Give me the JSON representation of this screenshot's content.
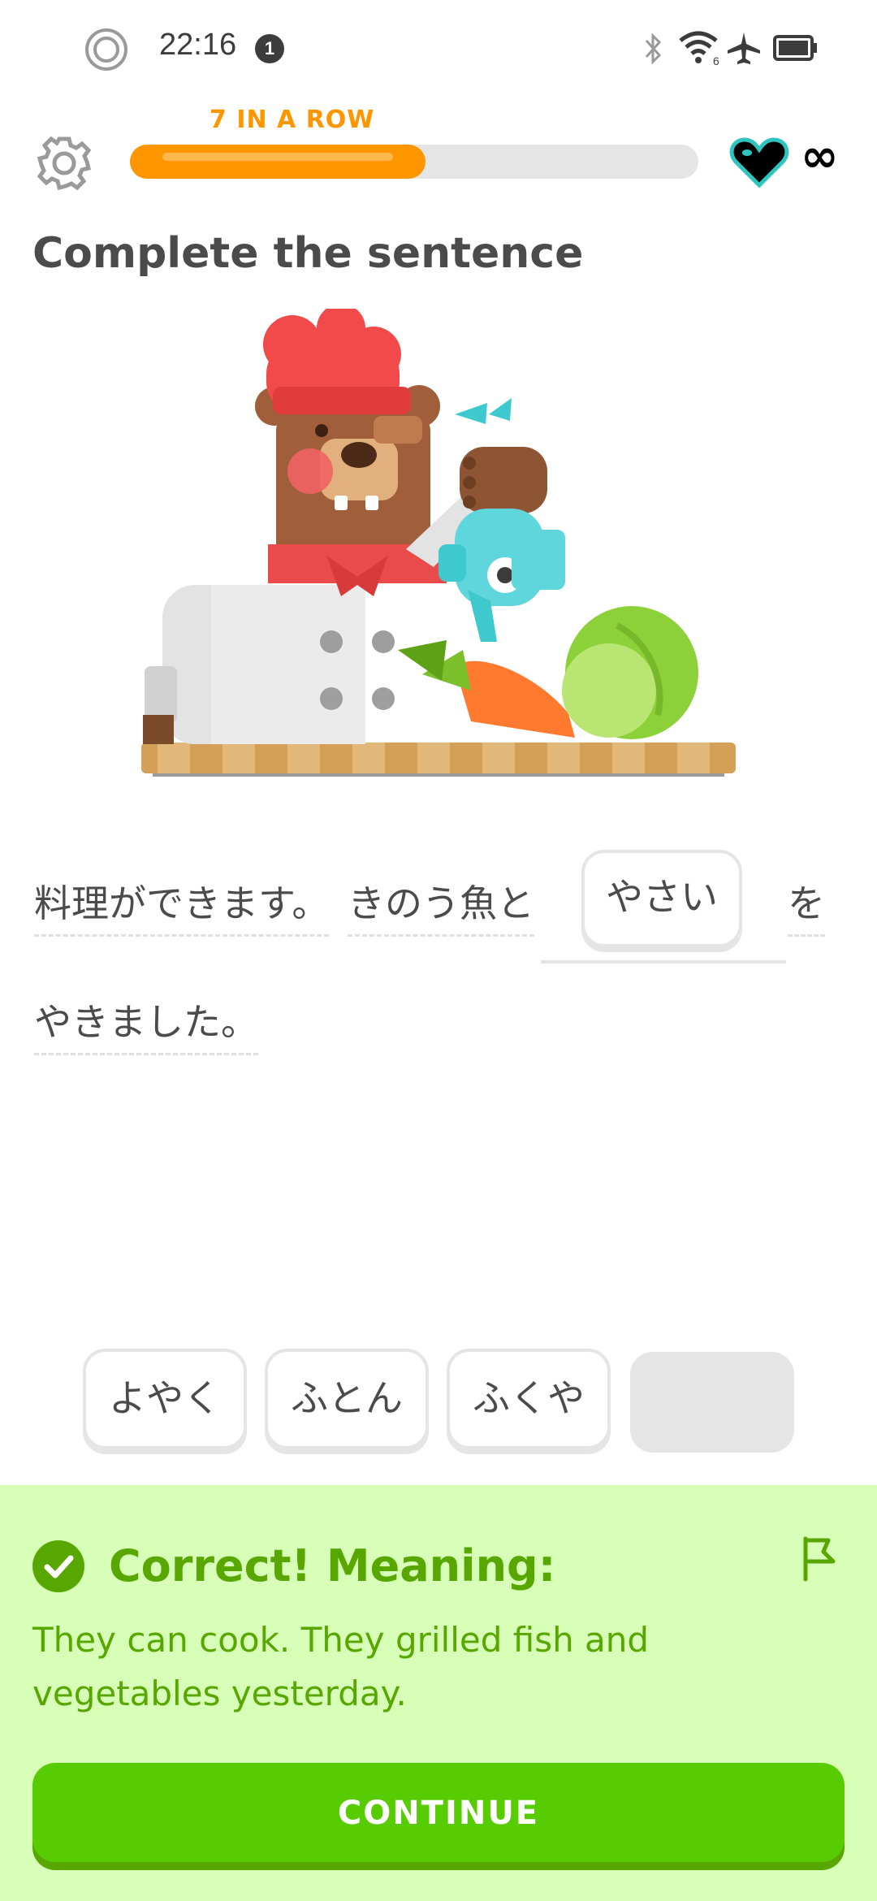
{
  "status_bar": {
    "time": "22:16",
    "notification_count": "1",
    "icons": [
      "circle-icon",
      "bluetooth-icon",
      "wifi-icon",
      "airplane-icon",
      "battery-icon"
    ]
  },
  "top_bar": {
    "streak_label": "7 IN A ROW",
    "progress_fraction": 0.52,
    "hearts": "∞",
    "accent_orange": "#ff9600"
  },
  "prompt": {
    "title": "Complete the sentence"
  },
  "sentence": {
    "part1": "料理ができます。",
    "part2": "きのう魚と",
    "answer": "やさい",
    "part3": "を",
    "part4": "やきました。"
  },
  "word_bank": {
    "options": [
      "よやく",
      "ふとん",
      "ふくや"
    ]
  },
  "feedback": {
    "title": "Correct! Meaning:",
    "meaning": "They can cook. They grilled fish and vegetables yesterday.",
    "continue_label": "CONTINUE",
    "accent_green": "#58cc02"
  }
}
